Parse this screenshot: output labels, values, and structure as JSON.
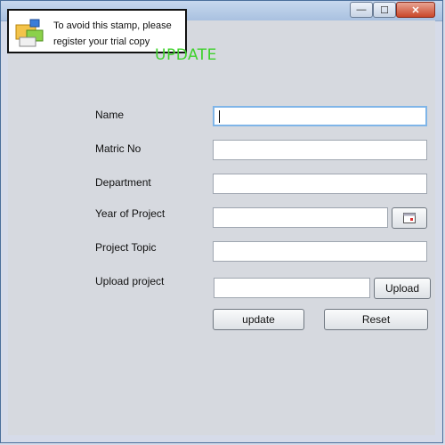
{
  "window": {
    "minimize_glyph": "—",
    "maximize_glyph": "☐",
    "close_glyph": "✕"
  },
  "stamp": {
    "line1": "To avoid this stamp, please",
    "line2": "register your trial copy",
    "icon": "window-stamp-icon"
  },
  "form": {
    "heading": "UPDATE",
    "fields": [
      {
        "label": "Name",
        "value": ""
      },
      {
        "label": "Matric No",
        "value": ""
      },
      {
        "label": "Department",
        "value": ""
      },
      {
        "label": "Year of Project",
        "value": ""
      },
      {
        "label": "Project Topic",
        "value": ""
      },
      {
        "label": "Upload project",
        "value": ""
      }
    ],
    "date_picker_icon": "calendar-icon",
    "upload_label": "Upload",
    "update_label": "update",
    "reset_label": "Reset"
  },
  "colors": {
    "heading": "#3fd12c",
    "background": "#d6d9df",
    "focus_border": "#7fb5e8"
  }
}
